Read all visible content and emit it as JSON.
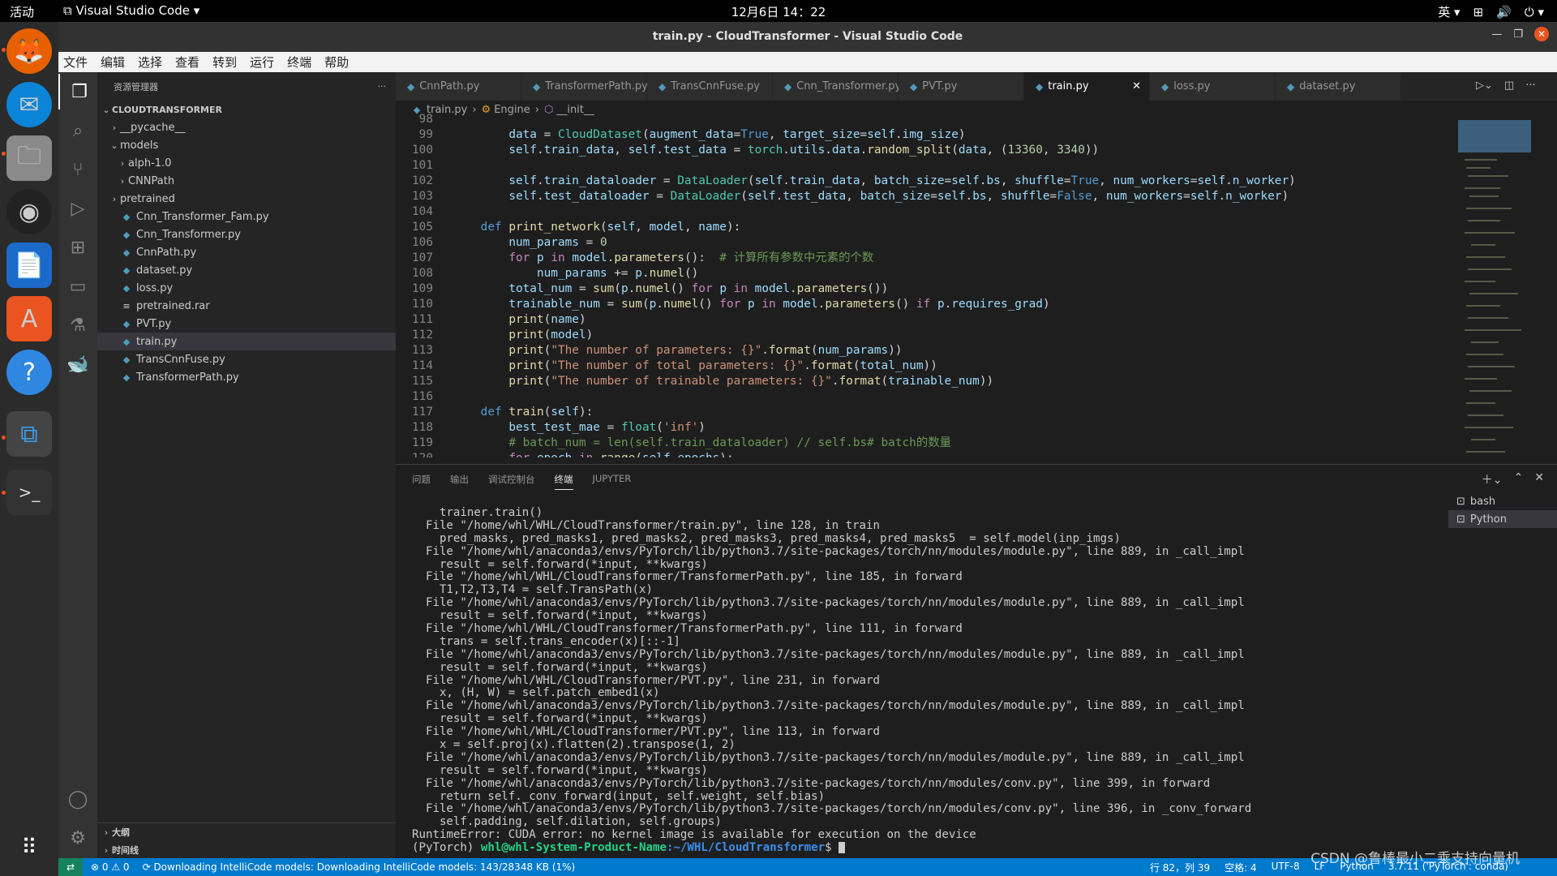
{
  "os": {
    "activities": "活动",
    "app_name": "Visual Studio Code",
    "clock": "12月6日  14：22",
    "input_method": "英"
  },
  "window": {
    "title": "train.py - CloudTransformer - Visual Studio Code"
  },
  "menu": [
    "文件",
    "编辑",
    "选择",
    "查看",
    "转到",
    "运行",
    "终端",
    "帮助"
  ],
  "sidebar": {
    "header": "资源管理器",
    "root": "CLOUDTRANSFORMER",
    "items": [
      {
        "label": "__pycache__",
        "type": "folder",
        "depth": 1,
        "open": false
      },
      {
        "label": "models",
        "type": "folder",
        "depth": 1,
        "open": true
      },
      {
        "label": "alph-1.0",
        "type": "folder",
        "depth": 2,
        "open": false
      },
      {
        "label": "CNNPath",
        "type": "folder",
        "depth": 2,
        "open": false
      },
      {
        "label": "pretrained",
        "type": "folder",
        "depth": 1,
        "open": false
      },
      {
        "label": "Cnn_Transformer_Fam.py",
        "type": "py",
        "depth": 1
      },
      {
        "label": "Cnn_Transformer.py",
        "type": "py",
        "depth": 1
      },
      {
        "label": "CnnPath.py",
        "type": "py",
        "depth": 1
      },
      {
        "label": "dataset.py",
        "type": "py",
        "depth": 1
      },
      {
        "label": "loss.py",
        "type": "py",
        "depth": 1
      },
      {
        "label": "pretrained.rar",
        "type": "file",
        "depth": 1
      },
      {
        "label": "PVT.py",
        "type": "py",
        "depth": 1
      },
      {
        "label": "train.py",
        "type": "py",
        "depth": 1,
        "selected": true
      },
      {
        "label": "TransCnnFuse.py",
        "type": "py",
        "depth": 1
      },
      {
        "label": "TransformerPath.py",
        "type": "py",
        "depth": 1
      }
    ],
    "outline": "大纲",
    "timeline": "时间线"
  },
  "tabs": [
    {
      "label": "CnnPath.py"
    },
    {
      "label": "TransformerPath.py"
    },
    {
      "label": "TransCnnFuse.py"
    },
    {
      "label": "Cnn_Transformer.py"
    },
    {
      "label": "PVT.py"
    },
    {
      "label": "train.py",
      "active": true
    },
    {
      "label": "loss.py"
    },
    {
      "label": "dataset.py"
    }
  ],
  "breadcrumbs": [
    "train.py",
    "Engine",
    "__init__"
  ],
  "code_lines": [
    {
      "n": "98",
      "html": ""
    },
    {
      "n": "99",
      "html": "        <span class='var'>data</span> = <span class='cls'>CloudDataset</span>(<span class='var'>augment_data</span>=<span class='kw'>True</span>, <span class='var'>target_size</span>=<span class='var'>self</span>.<span class='var'>img_size</span>)"
    },
    {
      "n": "100",
      "html": "        <span class='var'>self</span>.<span class='var'>train_data</span>, <span class='var'>self</span>.<span class='var'>test_data</span> = <span class='cls'>torch</span>.<span class='var'>utils</span>.<span class='var'>data</span>.<span class='fn'>random_split</span>(<span class='var'>data</span>, (<span class='num'>13360</span>, <span class='num'>3340</span>))"
    },
    {
      "n": "101",
      "html": ""
    },
    {
      "n": "102",
      "html": "        <span class='var'>self</span>.<span class='var'>train_dataloader</span> = <span class='cls'>DataLoader</span>(<span class='var'>self</span>.<span class='var'>train_data</span>, <span class='var'>batch_size</span>=<span class='var'>self</span>.<span class='var'>bs</span>, <span class='var'>shuffle</span>=<span class='kw'>True</span>, <span class='var'>num_workers</span>=<span class='var'>self</span>.<span class='var'>n_worker</span>)"
    },
    {
      "n": "103",
      "html": "        <span class='var'>self</span>.<span class='var'>test_dataloader</span> = <span class='cls'>DataLoader</span>(<span class='var'>self</span>.<span class='var'>test_data</span>, <span class='var'>batch_size</span>=<span class='var'>self</span>.<span class='var'>bs</span>, <span class='var'>shuffle</span>=<span class='kw'>False</span>, <span class='var'>num_workers</span>=<span class='var'>self</span>.<span class='var'>n_worker</span>)"
    },
    {
      "n": "104",
      "html": ""
    },
    {
      "n": "105",
      "html": "    <span class='kw'>def</span> <span class='fn'>print_network</span>(<span class='var'>self</span>, <span class='var'>model</span>, <span class='var'>name</span>):"
    },
    {
      "n": "106",
      "html": "        <span class='var'>num_params</span> = <span class='num'>0</span>"
    },
    {
      "n": "107",
      "html": "        <span class='ctl'>for</span> <span class='var'>p</span> <span class='ctl'>in</span> <span class='var'>model</span>.<span class='fn'>parameters</span>():  <span class='com'># 计算所有参数中元素的个数</span>"
    },
    {
      "n": "108",
      "html": "            <span class='var'>num_params</span> += <span class='var'>p</span>.<span class='fn'>numel</span>()"
    },
    {
      "n": "109",
      "html": "        <span class='var'>total_num</span> = <span class='fn'>sum</span>(<span class='var'>p</span>.<span class='fn'>numel</span>() <span class='ctl'>for</span> <span class='var'>p</span> <span class='ctl'>in</span> <span class='var'>model</span>.<span class='fn'>parameters</span>())"
    },
    {
      "n": "110",
      "html": "        <span class='var'>trainable_num</span> = <span class='fn'>sum</span>(<span class='var'>p</span>.<span class='fn'>numel</span>() <span class='ctl'>for</span> <span class='var'>p</span> <span class='ctl'>in</span> <span class='var'>model</span>.<span class='fn'>parameters</span>() <span class='ctl'>if</span> <span class='var'>p</span>.<span class='var'>requires_grad</span>)"
    },
    {
      "n": "111",
      "html": "        <span class='fn'>print</span>(<span class='var'>name</span>)"
    },
    {
      "n": "112",
      "html": "        <span class='fn'>print</span>(<span class='var'>model</span>)"
    },
    {
      "n": "113",
      "html": "        <span class='fn'>print</span>(<span class='str'>\"The number of parameters: {}\"</span>.<span class='fn'>format</span>(<span class='var'>num_params</span>))"
    },
    {
      "n": "114",
      "html": "        <span class='fn'>print</span>(<span class='str'>\"The number of total parameters: {}\"</span>.<span class='fn'>format</span>(<span class='var'>total_num</span>))"
    },
    {
      "n": "115",
      "html": "        <span class='fn'>print</span>(<span class='str'>\"The number of trainable parameters: {}\"</span>.<span class='fn'>format</span>(<span class='var'>trainable_num</span>))"
    },
    {
      "n": "116",
      "html": ""
    },
    {
      "n": "117",
      "html": "    <span class='kw'>def</span> <span class='fn'>train</span>(<span class='var'>self</span>):"
    },
    {
      "n": "118",
      "html": "        <span class='var'>best_test_mae</span> = <span class='cls'>float</span>(<span class='str'>'inf'</span>)"
    },
    {
      "n": "119",
      "html": "        <span class='com'># batch_num = len(self.train_dataloader) // self.bs# batch的数量</span>"
    },
    {
      "n": "120",
      "html": "        <span class='ctl'>for</span> <span class='var'>epoch</span> <span class='ctl'>in</span> <span class='fn'>range</span>(<span class='var'>self</span>.<span class='var'>epochs</span>):"
    }
  ],
  "panel": {
    "tabs": [
      "问题",
      "输出",
      "调试控制台",
      "终端",
      "JUPYTER"
    ],
    "active_tab": "终端",
    "terminals": [
      "bash",
      "Python"
    ],
    "active_terminal": "Python"
  },
  "terminal_lines": [
    "    trainer.train()",
    "  File \"/home/whl/WHL/CloudTransformer/train.py\", line 128, in train",
    "    pred_masks, pred_masks1, pred_masks2, pred_masks3, pred_masks4, pred_masks5  = self.model(inp_imgs)",
    "  File \"/home/whl/anaconda3/envs/PyTorch/lib/python3.7/site-packages/torch/nn/modules/module.py\", line 889, in _call_impl",
    "    result = self.forward(*input, **kwargs)",
    "  File \"/home/whl/WHL/CloudTransformer/TransformerPath.py\", line 185, in forward",
    "    T1,T2,T3,T4 = self.TransPath(x)",
    "  File \"/home/whl/anaconda3/envs/PyTorch/lib/python3.7/site-packages/torch/nn/modules/module.py\", line 889, in _call_impl",
    "    result = self.forward(*input, **kwargs)",
    "  File \"/home/whl/WHL/CloudTransformer/TransformerPath.py\", line 111, in forward",
    "    trans = self.trans_encoder(x)[::-1]",
    "  File \"/home/whl/anaconda3/envs/PyTorch/lib/python3.7/site-packages/torch/nn/modules/module.py\", line 889, in _call_impl",
    "    result = self.forward(*input, **kwargs)",
    "  File \"/home/whl/WHL/CloudTransformer/PVT.py\", line 231, in forward",
    "    x, (H, W) = self.patch_embed1(x)",
    "  File \"/home/whl/anaconda3/envs/PyTorch/lib/python3.7/site-packages/torch/nn/modules/module.py\", line 889, in _call_impl",
    "    result = self.forward(*input, **kwargs)",
    "  File \"/home/whl/WHL/CloudTransformer/PVT.py\", line 113, in forward",
    "    x = self.proj(x).flatten(2).transpose(1, 2)",
    "  File \"/home/whl/anaconda3/envs/PyTorch/lib/python3.7/site-packages/torch/nn/modules/module.py\", line 889, in _call_impl",
    "    result = self.forward(*input, **kwargs)",
    "  File \"/home/whl/anaconda3/envs/PyTorch/lib/python3.7/site-packages/torch/nn/modules/conv.py\", line 399, in forward",
    "    return self._conv_forward(input, self.weight, self.bias)",
    "  File \"/home/whl/anaconda3/envs/PyTorch/lib/python3.7/site-packages/torch/nn/modules/conv.py\", line 396, in _conv_forward",
    "    self.padding, self.dilation, self.groups)",
    "RuntimeError: CUDA error: no kernel image is available for execution on the device"
  ],
  "prompt": {
    "env": "(PyTorch) ",
    "user": "whl@whl-System-Product-Name",
    "path": ":~/WHL/CloudTransformer",
    "symbol": "$ "
  },
  "status": {
    "errors": "0",
    "warnings": "0",
    "message": "Downloading IntelliCode models: Downloading IntelliCode models: 143/28348 KB (1%)",
    "position": "行 82，列 39",
    "spaces": "空格: 4",
    "encoding": "UTF-8",
    "eol": "LF",
    "language": "Python",
    "interpreter": "3.7.11 ('PyTorch': conda)"
  },
  "watermark": "CSDN @鲁棒最小二乘支持向量机"
}
